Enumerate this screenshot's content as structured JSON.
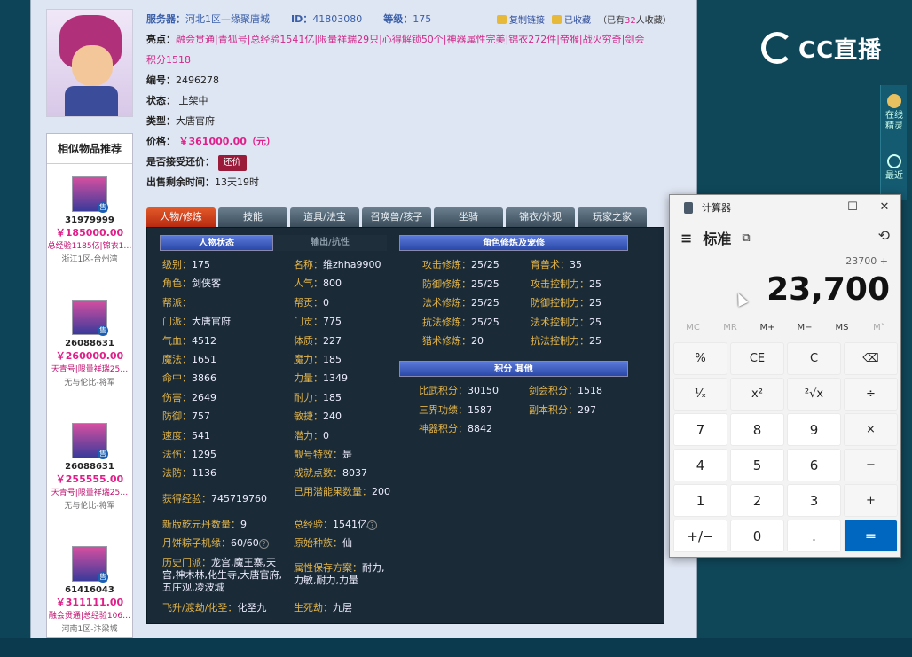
{
  "header": {
    "server_label": "服务器：",
    "server_value": "河北1区—缘聚唐城",
    "id_label": "ID：",
    "id_value": "41803080",
    "level_label": "等级：",
    "level_value": "175",
    "copy_link": "复制链接",
    "favorited": "已收藏",
    "fav_count_prefix": "（已有",
    "fav_count": "32",
    "fav_count_suffix": "人收藏）"
  },
  "info": {
    "highlights_label": "亮点：",
    "highlights_line1": "融会贯通|青狐号|总经验1541亿|限量祥瑞29只|心得解锁50个|神器属性完美|锦衣272件|帝猴|战火穷奇|剑会",
    "highlights_line2": "积分1518",
    "number_label": "编号：",
    "number_value": "2496278",
    "status_label": "状态：",
    "status_value": "上架中",
    "type_label": "类型：",
    "type_value": "大唐官府",
    "price_label": "价格：",
    "price_value": "￥361000.00（元）",
    "counter_label": "是否接受还价：",
    "counter_button": "还价",
    "time_label": "出售剩余时间：",
    "time_value": "13天19时"
  },
  "similar": {
    "title": "相似物品推荐",
    "badge": "售",
    "items": [
      {
        "id": "31979999",
        "price": "￥185000.00",
        "tags": "总经验1185亿|锦衣1…",
        "server": "浙江1区-台州湾"
      },
      {
        "id": "26088631",
        "price": "￥260000.00",
        "tags": "天青号|限量祥瑞25…",
        "server": "无与伦比-将军"
      },
      {
        "id": "26088631",
        "price": "￥255555.00",
        "tags": "天青号|限量祥瑞25…",
        "server": "无与伦比-将军"
      },
      {
        "id": "61416043",
        "price": "￥311111.00",
        "tags": "融会贯通|总经验106…",
        "server": "河南1区-汴梁城"
      }
    ]
  },
  "tabs": [
    "人物/修炼",
    "技能",
    "道具/法宝",
    "召唤兽/孩子",
    "坐骑",
    "锦衣/外观",
    "玩家之家"
  ],
  "panel": {
    "sec_char": "人物状态",
    "sec_out": "输出/抗性",
    "sec_cult": "角色修炼及宠修",
    "sec_score": "积分 其他",
    "char_left": [
      {
        "k": "级别：",
        "v": "175"
      },
      {
        "k": "角色：",
        "v": "剑侠客"
      },
      {
        "k": "帮派：",
        "v": ""
      },
      {
        "k": "门派：",
        "v": "大唐官府"
      },
      {
        "k": "气血：",
        "v": "4512"
      },
      {
        "k": "魔法：",
        "v": "1651"
      },
      {
        "k": "命中：",
        "v": "3866"
      },
      {
        "k": "伤害：",
        "v": "2649"
      },
      {
        "k": "防御：",
        "v": "757"
      },
      {
        "k": "速度：",
        "v": "541"
      },
      {
        "k": "法伤：",
        "v": "1295"
      },
      {
        "k": "法防：",
        "v": "1136"
      }
    ],
    "char_right": [
      {
        "k": "名称：",
        "v": "维zhha9900"
      },
      {
        "k": "人气：",
        "v": "800"
      },
      {
        "k": "帮贡：",
        "v": "0"
      },
      {
        "k": "门贡：",
        "v": "775"
      },
      {
        "k": "体质：",
        "v": "227"
      },
      {
        "k": "魔力：",
        "v": "185"
      },
      {
        "k": "力量：",
        "v": "1349"
      },
      {
        "k": "耐力：",
        "v": "185"
      },
      {
        "k": "敏捷：",
        "v": "240"
      },
      {
        "k": "潜力：",
        "v": "0"
      },
      {
        "k": "靓号特效：",
        "v": "是"
      },
      {
        "k": "成就点数：",
        "v": "8037"
      }
    ],
    "exp_k": "获得经验：",
    "exp_v": "745719760",
    "used_k": "已用潜能果数量：",
    "used_v": "200",
    "qiankun_k": "新版乾元丹数量：",
    "qiankun_v": "9",
    "total_exp_k": "总经验：",
    "total_exp_v": "1541亿",
    "mooncake_k": "月饼粽子机缘：",
    "mooncake_v": "60/60",
    "race_k": "原始种族：",
    "race_v": "仙",
    "history_k": "历史门派：",
    "history_v": "龙宫,魔王寨,天宫,神木林,化生寺,大唐官府,五庄观,凌波城",
    "attr_save_k": "属性保存方案：",
    "attr_save_v": "耐力,力敏,耐力,力量",
    "fly_k": "飞升/渡劫/化圣：",
    "fly_v": "化圣九",
    "life_k": "生死劫：",
    "life_v": "九层",
    "cult_left": [
      {
        "k": "攻击修炼：",
        "v": "25/25"
      },
      {
        "k": "防御修炼：",
        "v": "25/25"
      },
      {
        "k": "法术修炼：",
        "v": "25/25"
      },
      {
        "k": "抗法修炼：",
        "v": "25/25"
      },
      {
        "k": "猎术修炼：",
        "v": "20"
      }
    ],
    "cult_right": [
      {
        "k": "育兽术：",
        "v": "35"
      },
      {
        "k": "攻击控制力：",
        "v": "25"
      },
      {
        "k": "防御控制力：",
        "v": "25"
      },
      {
        "k": "法术控制力：",
        "v": "25"
      },
      {
        "k": "抗法控制力：",
        "v": "25"
      }
    ],
    "score_left": [
      {
        "k": "比武积分：",
        "v": "30150"
      },
      {
        "k": "三界功绩：",
        "v": "1587"
      },
      {
        "k": "神器积分：",
        "v": "8842"
      }
    ],
    "score_right": [
      {
        "k": "剑会积分：",
        "v": "1518"
      },
      {
        "k": "副本积分：",
        "v": "297"
      }
    ]
  },
  "stream": {
    "logo_text": "CC直播",
    "side_online_1": "在线",
    "side_online_2": "精灵",
    "side_latest": "最近"
  },
  "calculator": {
    "title": "计算器",
    "mode": "标准",
    "expression": "23700 +",
    "display": "23,700",
    "memory": [
      "MC",
      "MR",
      "M+",
      "M−",
      "MS",
      "M˅"
    ],
    "keys": [
      "%",
      "CE",
      "C",
      "⌫",
      "¹⁄ₓ",
      "x²",
      "²√x",
      "÷",
      "7",
      "8",
      "9",
      "×",
      "4",
      "5",
      "6",
      "−",
      "1",
      "2",
      "3",
      "+",
      "+/−",
      "0",
      ".",
      "="
    ],
    "minimize": "—",
    "maximize": "☐",
    "close": "✕",
    "menu": "≡",
    "keep_on_top": "⧉",
    "history": "⟲"
  }
}
